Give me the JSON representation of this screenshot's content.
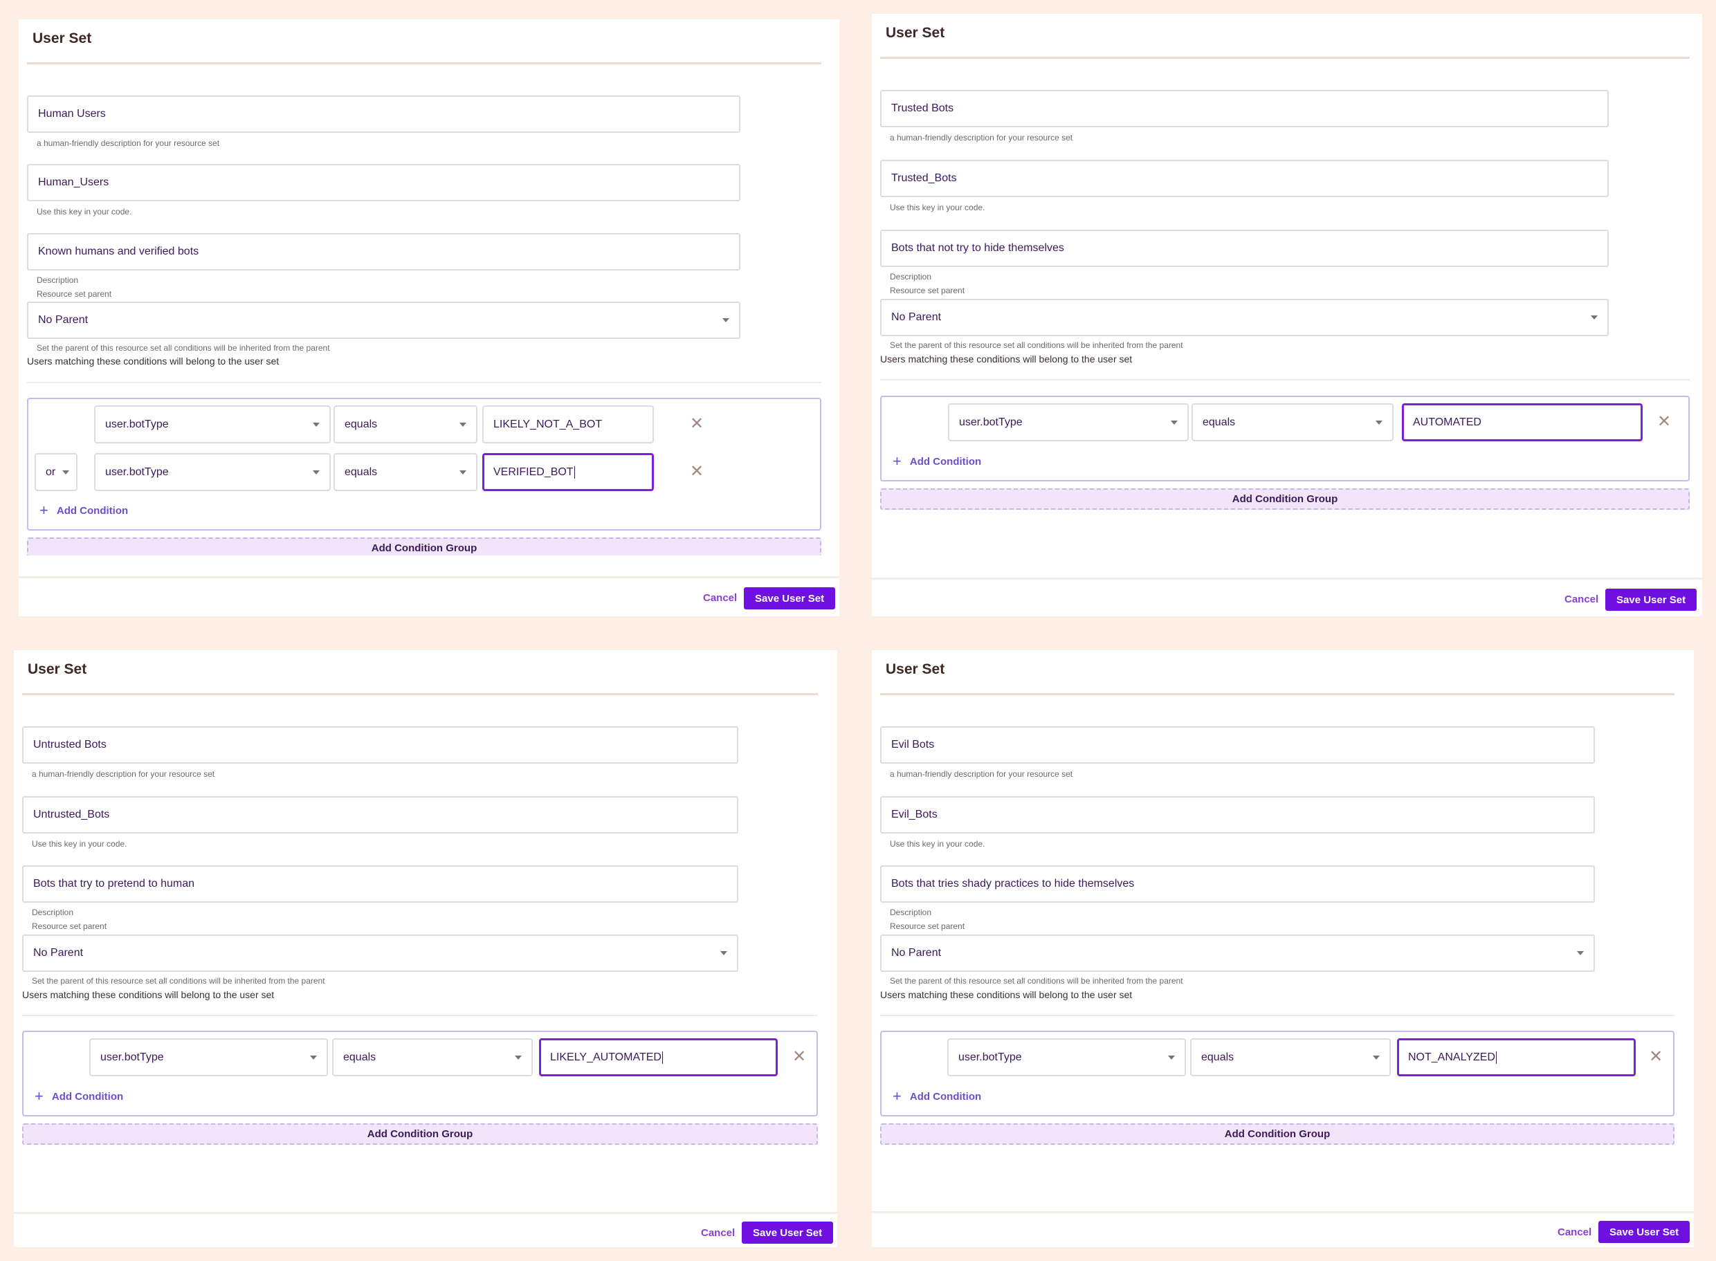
{
  "colors": {
    "background": "#fdefe6",
    "accent": "#7010e0",
    "field_text": "#3b1a5a",
    "group_border": "#c8b8f0",
    "add_group_bg": "#f2e5fa"
  },
  "common": {
    "title": "User Set",
    "name_helper": "a human-friendly description for your resource set",
    "key_helper": "Use this key in your code.",
    "description_label": "Description",
    "parent_label": "Resource set parent",
    "parent_helper": "Set the parent of this resource set all conditions will be inherited from the parent",
    "users_matching": "Users matching these conditions will belong to the user set",
    "add_condition": "Add Condition",
    "add_condition_group": "Add Condition Group",
    "cancel": "Cancel",
    "save": "Save User Set",
    "icons": {
      "remove": "close-x-icon",
      "add": "plus-icon",
      "dropdown": "chevron-down-icon"
    }
  },
  "panels": [
    {
      "name": "Human Users",
      "key": "Human_Users",
      "description": "Known humans and verified bots",
      "parent": "No Parent",
      "conditions": [
        {
          "connector": "",
          "attribute": "user.botType",
          "operator": "equals",
          "value": "LIKELY_NOT_A_BOT",
          "focused": false
        },
        {
          "connector": "or",
          "attribute": "user.botType",
          "operator": "equals",
          "value": "VERIFIED_BOT",
          "focused": true
        }
      ]
    },
    {
      "name": "Trusted Bots",
      "key": "Trusted_Bots",
      "description": "Bots that not try to hide themselves",
      "parent": "No Parent",
      "conditions": [
        {
          "connector": "",
          "attribute": "user.botType",
          "operator": "equals",
          "value": "AUTOMATED",
          "focused": true
        }
      ]
    },
    {
      "name": "Untrusted Bots",
      "key": "Untrusted_Bots",
      "description": "Bots that try to pretend to human",
      "parent": "No Parent",
      "conditions": [
        {
          "connector": "",
          "attribute": "user.botType",
          "operator": "equals",
          "value": "LIKELY_AUTOMATED",
          "focused": true
        }
      ]
    },
    {
      "name": "Evil Bots",
      "key": "Evil_Bots",
      "description": "Bots that tries shady practices to hide themselves",
      "parent": "No Parent",
      "conditions": [
        {
          "connector": "",
          "attribute": "user.botType",
          "operator": "equals",
          "value": "NOT_ANALYZED",
          "focused": true
        }
      ]
    }
  ]
}
